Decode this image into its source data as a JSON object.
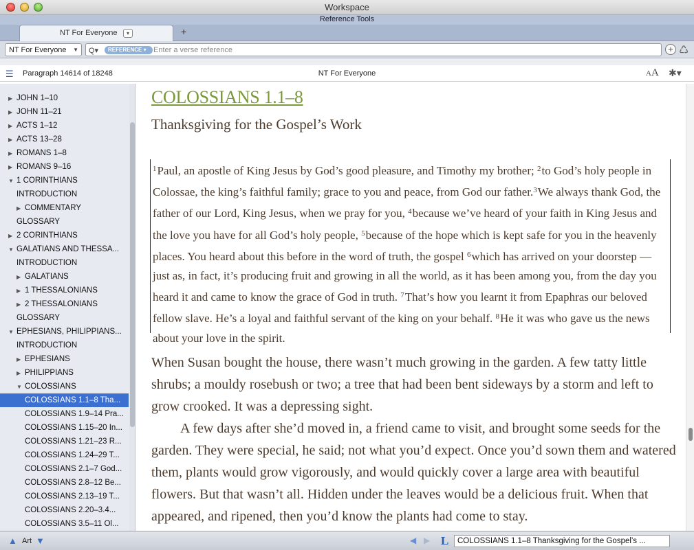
{
  "window": {
    "title": "Workspace",
    "subtitle": "Reference Tools"
  },
  "tab": {
    "label": "NT For Everyone",
    "menu_glyph": "▾",
    "add_glyph": "+"
  },
  "toolbar": {
    "resource": "NT For Everyone",
    "resource_arrow": "▼",
    "search_glyph": "Q▾",
    "mode": "REFERENCE ▾",
    "placeholder": "Enter a verse reference",
    "add_glyph": "+",
    "link_glyph": "♺"
  },
  "panel": {
    "location": "Paragraph 14614 of 18248",
    "title": "NT For Everyone",
    "font_small": "A",
    "font_big": "A",
    "settings_glyph": "✱▾",
    "list_glyph": "☰"
  },
  "sidebar": {
    "items": [
      {
        "label": "JOHN 1–10",
        "tri": "▶",
        "indent": 0
      },
      {
        "label": "JOHN 11–21",
        "tri": "▶",
        "indent": 0
      },
      {
        "label": "ACTS 1–12",
        "tri": "▶",
        "indent": 0
      },
      {
        "label": "ACTS 13–28",
        "tri": "▶",
        "indent": 0
      },
      {
        "label": "ROMANS 1–8",
        "tri": "▶",
        "indent": 0
      },
      {
        "label": "ROMANS 9–16",
        "tri": "▶",
        "indent": 0
      },
      {
        "label": "1 CORINTHIANS",
        "tri": "▼",
        "indent": 0
      },
      {
        "label": "INTRODUCTION",
        "tri": "",
        "indent": 1
      },
      {
        "label": "COMMENTARY",
        "tri": "▶",
        "indent": 1
      },
      {
        "label": "GLOSSARY",
        "tri": "",
        "indent": 1
      },
      {
        "label": "2 CORINTHIANS",
        "tri": "▶",
        "indent": 0
      },
      {
        "label": "GALATIANS AND THESSA...",
        "tri": "▼",
        "indent": 0
      },
      {
        "label": "INTRODUCTION",
        "tri": "",
        "indent": 1
      },
      {
        "label": "GALATIANS",
        "tri": "▶",
        "indent": 1
      },
      {
        "label": "1 THESSALONIANS",
        "tri": "▶",
        "indent": 1
      },
      {
        "label": "2 THESSALONIANS",
        "tri": "▶",
        "indent": 1
      },
      {
        "label": "GLOSSARY",
        "tri": "",
        "indent": 1
      },
      {
        "label": "EPHESIANS, PHILIPPIANS...",
        "tri": "▼",
        "indent": 0
      },
      {
        "label": "INTRODUCTION",
        "tri": "",
        "indent": 1
      },
      {
        "label": "EPHESIANS",
        "tri": "▶",
        "indent": 1
      },
      {
        "label": "PHILIPPIANS",
        "tri": "▶",
        "indent": 1
      },
      {
        "label": "COLOSSIANS",
        "tri": "▼",
        "indent": 1
      },
      {
        "label": "COLOSSIANS 1.1–8 Tha...",
        "tri": "",
        "indent": 2,
        "selected": true
      },
      {
        "label": "COLOSSIANS 1.9–14 Pra...",
        "tri": "",
        "indent": 2
      },
      {
        "label": "COLOSSIANS 1.15–20 In...",
        "tri": "",
        "indent": 2
      },
      {
        "label": "COLOSSIANS 1.21–23 R...",
        "tri": "",
        "indent": 2
      },
      {
        "label": "COLOSSIANS 1.24–29 T...",
        "tri": "",
        "indent": 2
      },
      {
        "label": "COLOSSIANS 2.1–7 God...",
        "tri": "",
        "indent": 2
      },
      {
        "label": "COLOSSIANS 2.8–12 Be...",
        "tri": "",
        "indent": 2
      },
      {
        "label": "COLOSSIANS 2.13–19 T...",
        "tri": "",
        "indent": 2
      },
      {
        "label": "COLOSSIANS 2.20–3.4...",
        "tri": "",
        "indent": 2
      },
      {
        "label": "COLOSSIANS 3.5–11 Ol...",
        "tri": "",
        "indent": 2
      }
    ]
  },
  "content": {
    "heading": "COLOSSIANS 1.1–8",
    "subheading": "Thanksgiving for the Gospel’s Work",
    "scripture": [
      {
        "n": "1",
        "text": "Paul, an apostle of King Jesus by God’s good pleasure, and Timothy my brother; "
      },
      {
        "n": "2",
        "text": "to God’s holy people in Colossae, the king’s faithful family; grace to you and peace, from God our father."
      },
      {
        "n": "3",
        "text": "We always thank God, the father of our Lord, King Jesus, when we pray for you, "
      },
      {
        "n": "4",
        "text": "because we’ve heard of your faith in King Jesus and the love you have for all God’s holy people, "
      },
      {
        "n": "5",
        "text": "because of the hope which is kept safe for you in the heavenly places. You heard about this before in the word of truth, the gospel "
      },
      {
        "n": "6",
        "text": "which has arrived on your doorstep — just as, in fact, it’s producing fruit and growing in all the world, as it has been among you, from the day you heard it and came to know the grace of God in truth. "
      },
      {
        "n": "7",
        "text": "That’s how you learnt it from Epaphras our beloved fellow slave. He’s a loyal and faithful servant of the king on your behalf. "
      },
      {
        "n": "8",
        "text": "He it was who gave us the news about your love in the spirit."
      }
    ],
    "commentary": [
      "When Susan bought the house, there wasn’t much growing in the garden. A few tatty little shrubs; a mouldy rosebush or two; a tree that had been bent sideways by a storm and left to grow crooked. It was a depressing sight.",
      "A few days after she’d moved in, a friend came to visit, and brought some seeds for the garden. They were special, he said; not what you’d expect. Once you’d sown them and watered them, plants would grow vigorously, and would quickly cover a large area with beautiful flowers. But that wasn’t all. Hidden under the leaves would be a delicious fruit. When that appeared, and ripened, then you’d know the plants had come to stay."
    ]
  },
  "bottom": {
    "up_glyph": "▲",
    "art_label": "Art",
    "down_glyph": "▼",
    "prev_glyph": "◀",
    "next_glyph": "▶",
    "link_glyph": "L",
    "location": "COLOSSIANS 1.1–8 Thanksgiving for the Gospel’s ..."
  },
  "colors": {
    "heading": "#7a9a3a",
    "body_text": "#4d3c2e",
    "selection": "#3b6fd0"
  }
}
